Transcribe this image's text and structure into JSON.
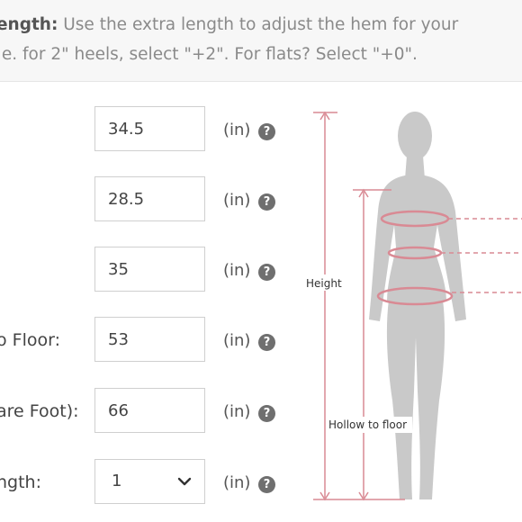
{
  "note": {
    "line1_bold": "ength:",
    "line1_rest": " Use the extra length to adjust the hem for your",
    "line2": ".e. for 2\" heels, select \"+2\". For flats? Select \"+0\"."
  },
  "rows": [
    {
      "label": "",
      "value": "34.5",
      "unit": "(in)",
      "help": "?"
    },
    {
      "label": "",
      "value": "28.5",
      "unit": "(in)",
      "help": "?"
    },
    {
      "label": "",
      "value": "35",
      "unit": "(in)",
      "help": "?"
    },
    {
      "label": "o Floor:",
      "value": "53",
      "unit": "(in)",
      "help": "?"
    },
    {
      "label": "are Foot):",
      "value": "66",
      "unit": "(in)",
      "help": "?"
    },
    {
      "label": "ngth:",
      "value": "1",
      "unit": "(in)",
      "help": "?"
    }
  ],
  "figure": {
    "height_label": "Height",
    "hollow_label": "Hollow to floor",
    "icon": "female-silhouette-icon",
    "accent_color": "#d98a94",
    "silhouette_color": "#c9c9c9"
  }
}
